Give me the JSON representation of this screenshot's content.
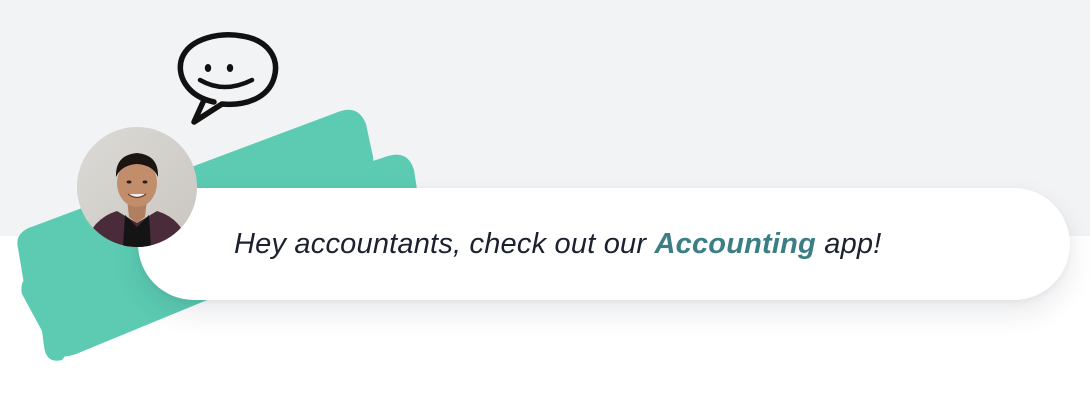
{
  "message": {
    "before": "Hey accountants, check out our ",
    "highlight": "Accounting",
    "after": " app!"
  },
  "icons": {
    "speech": "chat-bubble-smile-icon",
    "avatar": "profile-photo"
  },
  "colors": {
    "band": "#f2f3f5",
    "brush": "#5ccbb2",
    "highlight": "#3b7f84",
    "text": "#1c2130"
  }
}
